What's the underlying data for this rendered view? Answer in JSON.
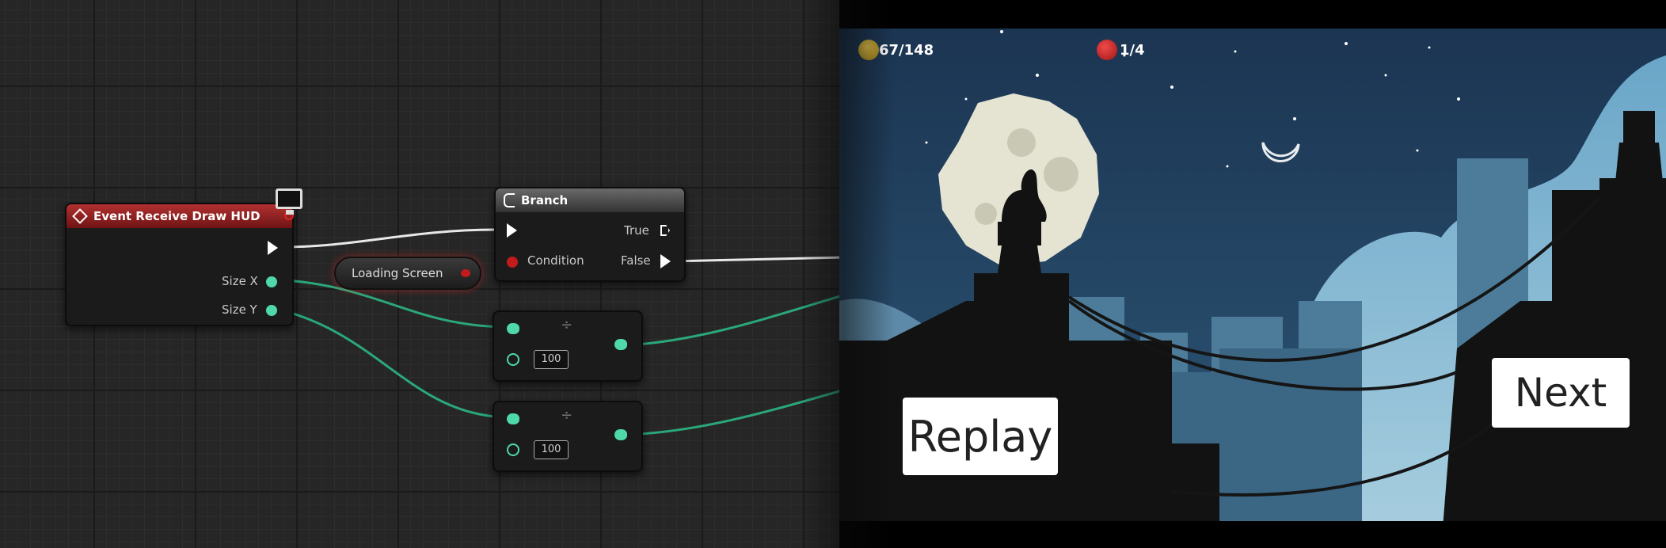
{
  "blueprint": {
    "event_node": {
      "title": "Event Receive Draw HUD",
      "pin_size_x": "Size X",
      "pin_size_y": "Size Y"
    },
    "branch_node": {
      "title": "Branch",
      "pin_condition": "Condition",
      "pin_true": "True",
      "pin_false": "False"
    },
    "variable_node": {
      "label": "Loading Screen"
    },
    "divide_node_1": {
      "symbol": "÷",
      "field_value": "100"
    },
    "divide_node_2": {
      "symbol": "÷",
      "field_value": "100"
    },
    "colors": {
      "event_header": "#b23030",
      "float_pin": "#4fd8a8",
      "bool_pin": "#c21b1b",
      "exec_pin": "#ffffff"
    }
  },
  "game": {
    "hud": {
      "coins": "67/148",
      "lives": "1/4"
    },
    "buttons": {
      "replay": "Replay",
      "next": "Next"
    },
    "colors": {
      "sky": "#1e3a55",
      "coin": "#c7a628",
      "life": "#d42a2a",
      "moon": "#e5e3d2"
    }
  }
}
